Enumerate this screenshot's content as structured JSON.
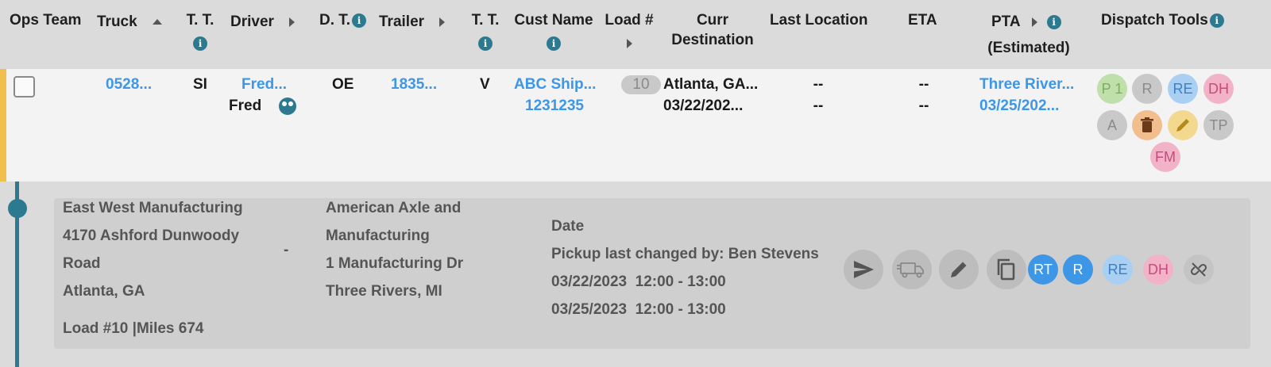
{
  "header": {
    "ops_team": "Ops Team",
    "truck": "Truck",
    "tt1_line1": "T. T.",
    "driver": "Driver",
    "dt": "D. T.",
    "trailer": "Trailer",
    "tt2_line1": "T. T.",
    "cust_name": "Cust Name",
    "load_num": "Load #",
    "curr_dest_line1": "Curr",
    "curr_dest_line2": "Destination",
    "last_location": "Last Location",
    "eta": "ETA",
    "pta_line1": "PTA",
    "pta_line2": "(Estimated)",
    "dispatch_tools": "Dispatch Tools",
    "info_glyph": "i"
  },
  "row": {
    "accent_color": "#f0c04a",
    "truck": "0528...",
    "tt1": "SI",
    "driver_link": "Fred...",
    "driver_name": "Fred",
    "dt": "OE",
    "trailer": "1835...",
    "tt2": "V",
    "cust_name": "ABC Ship...",
    "cust_id": "1231235",
    "load_num": "10",
    "curr_dest_city": "Atlanta, GA...",
    "curr_dest_date": "03/22/202...",
    "last_location_1": "--",
    "last_location_2": "--",
    "eta_1": "--",
    "eta_2": "--",
    "pta_city": "Three River...",
    "pta_date": "03/25/202..."
  },
  "tools": [
    {
      "label": "P 1",
      "bg": "#bfdfab",
      "fg": "#7daf5d"
    },
    {
      "label": "R",
      "bg": "#c9c9c9",
      "fg": "#8a8a8a"
    },
    {
      "label": "RE",
      "bg": "#a9cff3",
      "fg": "#3d7fc4"
    },
    {
      "label": "DH",
      "bg": "#f2b3c9",
      "fg": "#c84a7a"
    },
    {
      "label": "A",
      "bg": "#c9c9c9",
      "fg": "#8a8a8a"
    },
    {
      "label": "trash-icon",
      "bg": "#f2be8e",
      "fg": "#6b3b17"
    },
    {
      "label": "pencil-icon",
      "bg": "#f3d98f",
      "fg": "#b58a1a"
    },
    {
      "label": "TP",
      "bg": "#c9c9c9",
      "fg": "#8a8a8a"
    },
    {
      "label": "FM",
      "bg": "#f2b3c9",
      "fg": "#c84a7a"
    }
  ],
  "detail": {
    "origin_name": "East West Manufacturing",
    "origin_addr1": "4170 Ashford Dunwoody",
    "origin_addr2": "Road",
    "origin_city": "Atlanta, GA",
    "separator": "-",
    "dest_name1": "American Axle and",
    "dest_name2": "Manufacturing",
    "dest_addr": "1 Manufacturing Dr",
    "dest_city": "Three Rivers, MI",
    "date_label": "Date",
    "pickup_changed": "Pickup last changed by: Ben Stevens",
    "pickup_window": "03/22/2023  12:00 - 13:00",
    "delivery_window": "03/25/2023  12:00 - 13:00",
    "load_info": "Load #10 |Miles 674",
    "actions": {
      "rt": "RT",
      "r": "R",
      "re": "RE",
      "dh": "DH"
    }
  }
}
